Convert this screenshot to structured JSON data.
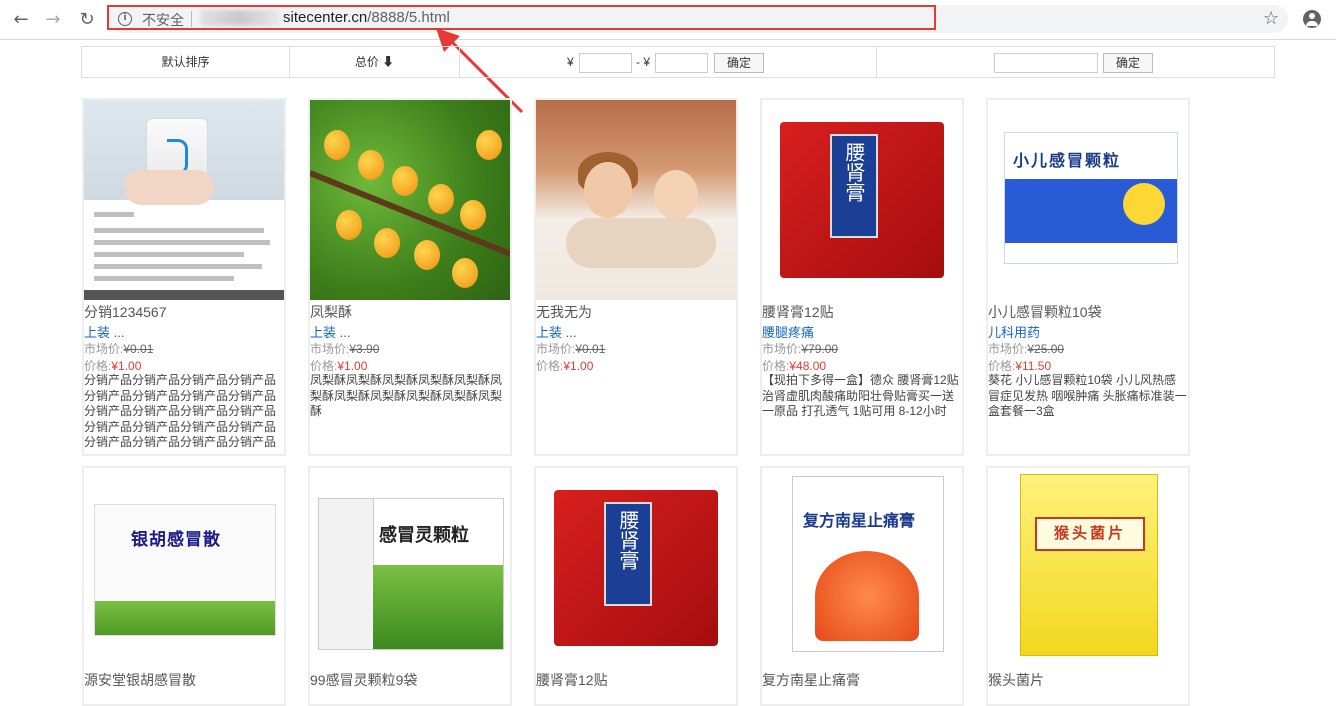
{
  "browser": {
    "security_label": "不安全",
    "url_host": "sitecenter.cn",
    "url_path": "/8888/5.html"
  },
  "filter": {
    "sort_default": "默认排序",
    "sort_price": "总价 ⬇",
    "yuan1": "¥",
    "dash_yuan": "- ¥",
    "confirm1": "确定",
    "confirm2": "确定"
  },
  "products": [
    {
      "title": "分销1234567",
      "category": "上装 ...",
      "market_label": "市场价:",
      "market_price": "¥0.01",
      "price_label": "价格:",
      "price": "¥1.00",
      "desc": "分销产品分销产品分销产品分销产品分销产品分销产品分销产品分销产品分销产品分销产品分销产品分销产品分销产品分销产品分销产品分销产品分销产品分销产品分销产品分销产品"
    },
    {
      "title": "凤梨酥",
      "category": "上装 ...",
      "market_label": "市场价:",
      "market_price": "¥3.90",
      "price_label": "价格:",
      "price": "¥1.00",
      "desc": "凤梨酥凤梨酥凤梨酥凤梨酥凤梨酥凤梨酥凤梨酥凤梨酥凤梨酥凤梨酥凤梨酥"
    },
    {
      "title": "无我无为",
      "category": "上装 ...",
      "market_label": "市场价:",
      "market_price": "¥0.01",
      "price_label": "价格:",
      "price": "¥1.00",
      "desc": ""
    },
    {
      "title": "腰肾膏12贴",
      "category": "腰腿疼痛",
      "market_label": "市场价:",
      "market_price": "¥79.00",
      "price_label": "价格:",
      "price": "¥48.00",
      "desc": "【现拍下多得一盒】德众 腰肾膏12贴 治肾虚肌肉酸痛助阳壮骨贴膏买一送一原品 打孔透气 1贴可用 8-12小时"
    },
    {
      "title": "小儿感冒颗粒10袋",
      "category": "儿科用药",
      "market_label": "市场价:",
      "market_price": "¥25.00",
      "price_label": "价格:",
      "price": "¥11.50",
      "desc": "葵花 小儿感冒颗粒10袋 小儿风热感冒症见发热 咽喉肿痛 头胀痛标准装一盒套餐一3盒"
    },
    {
      "title": "源安堂银胡感冒散",
      "category": "",
      "market_label": "",
      "market_price": "",
      "price_label": "",
      "price": "",
      "desc": ""
    },
    {
      "title": "99感冒灵颗粒9袋",
      "category": "",
      "market_label": "",
      "market_price": "",
      "price_label": "",
      "price": "",
      "desc": ""
    },
    {
      "title": "腰肾膏12贴",
      "category": "",
      "market_label": "",
      "market_price": "",
      "price_label": "",
      "price": "",
      "desc": ""
    },
    {
      "title": "复方南星止痛膏",
      "category": "",
      "market_label": "",
      "market_price": "",
      "price_label": "",
      "price": "",
      "desc": ""
    },
    {
      "title": "猴头菌片",
      "category": "",
      "market_label": "",
      "market_price": "",
      "price_label": "",
      "price": "",
      "desc": ""
    }
  ],
  "packaging": {
    "yaoshen": "腰肾膏",
    "xiaoer": "小儿感冒颗粒",
    "yinhu": "银胡感冒散",
    "ganmao": "感冒灵颗粒",
    "fangnan": "复方南星止痛膏",
    "houtou": "猴头菌片"
  },
  "colors": {
    "accent_red": "#e53935",
    "link_blue": "#1565c0"
  }
}
